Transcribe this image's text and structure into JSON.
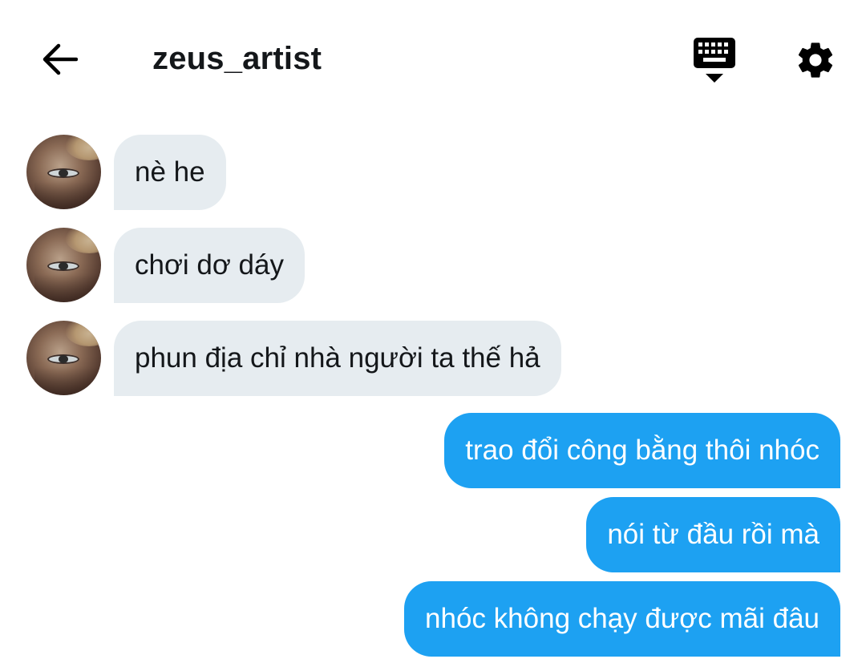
{
  "header": {
    "title": "zeus_artist",
    "back_icon": "arrow-left-icon",
    "keyboard_icon": "keyboard-hide-icon",
    "settings_icon": "gear-icon"
  },
  "messages": {
    "received": [
      {
        "text": "nè he"
      },
      {
        "text": "chơi dơ dáy"
      },
      {
        "text": "phun địa chỉ nhà người ta thế hả"
      }
    ],
    "sent": [
      {
        "text": "trao đổi công bằng thôi nhóc"
      },
      {
        "text": "nói từ đầu rồi mà"
      },
      {
        "text": "nhóc không chạy được mãi đâu"
      }
    ]
  },
  "colors": {
    "sent_bubble": "#1da1f2",
    "received_bubble": "#e6ecf0",
    "text": "#14171a"
  }
}
